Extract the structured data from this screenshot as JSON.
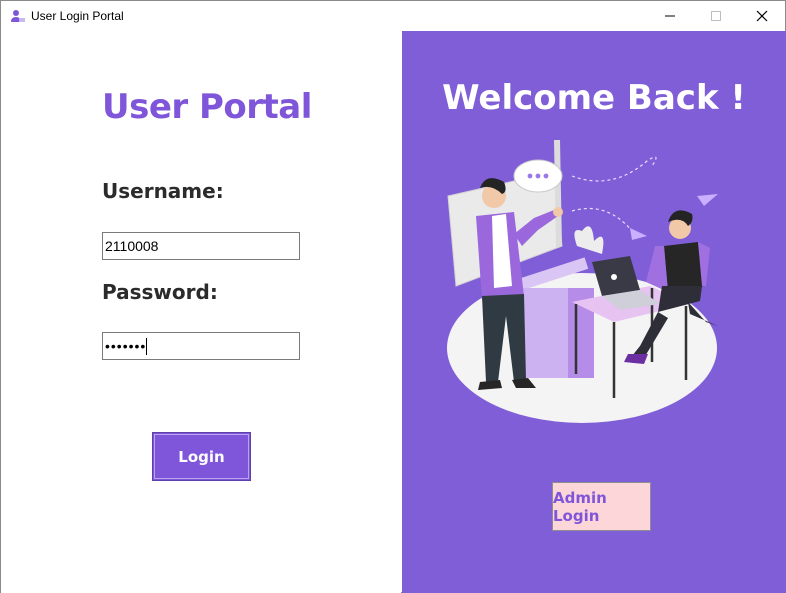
{
  "window": {
    "title": "User Login Portal",
    "controls": [
      "minimize-icon",
      "maximize-icon",
      "close-icon"
    ]
  },
  "left": {
    "heading": "User Portal",
    "username_label": "Username:",
    "username_value": "2110008",
    "password_label": "Password:",
    "password_value": "•••••••",
    "login_label": "Login"
  },
  "right": {
    "welcome": "Welcome Back !",
    "admin_label": "Admin Login",
    "illustration": "office-meeting-illustration"
  },
  "colors": {
    "accent": "#7f56d9",
    "right_bg": "#7f5ed8",
    "admin_bg": "#fcd6d8"
  }
}
